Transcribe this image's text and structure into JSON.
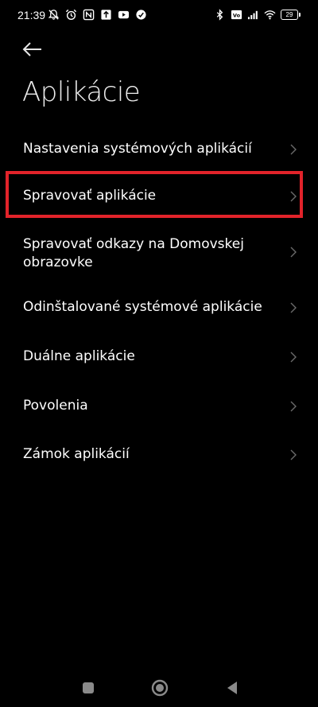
{
  "status_bar": {
    "time": "21:39",
    "battery_level": "29",
    "left_icons": [
      "bell-off-icon",
      "alarm-icon",
      "nfc-icon",
      "upload-icon",
      "youtube-icon",
      "app-notification-icon"
    ],
    "right_icons": [
      "bluetooth-icon",
      "volte-icon",
      "signal-icon",
      "wifi-icon",
      "battery-icon"
    ]
  },
  "header": {
    "back_icon": "arrow-left-icon",
    "title": "Aplikácie"
  },
  "menu": {
    "items": [
      {
        "label": "Nastavenia systémových aplikácií"
      },
      {
        "label": "Spravovať aplikácie"
      },
      {
        "label": "Spravovať odkazy na Domovskej obrazovke"
      },
      {
        "label": "Odinštalované systémové aplikácie"
      },
      {
        "label": "Duálne aplikácie"
      },
      {
        "label": "Povolenia"
      },
      {
        "label": "Zámok aplikácií"
      }
    ],
    "highlighted_index": 1
  },
  "colors": {
    "background": "#000000",
    "text": "#ffffff",
    "chevron": "#6b6b6b",
    "highlight": "#e2232a",
    "nav_icon": "#8a8a8a"
  },
  "nav_bar": {
    "icons": [
      "recents-square-icon",
      "home-circle-icon",
      "back-triangle-icon"
    ]
  }
}
